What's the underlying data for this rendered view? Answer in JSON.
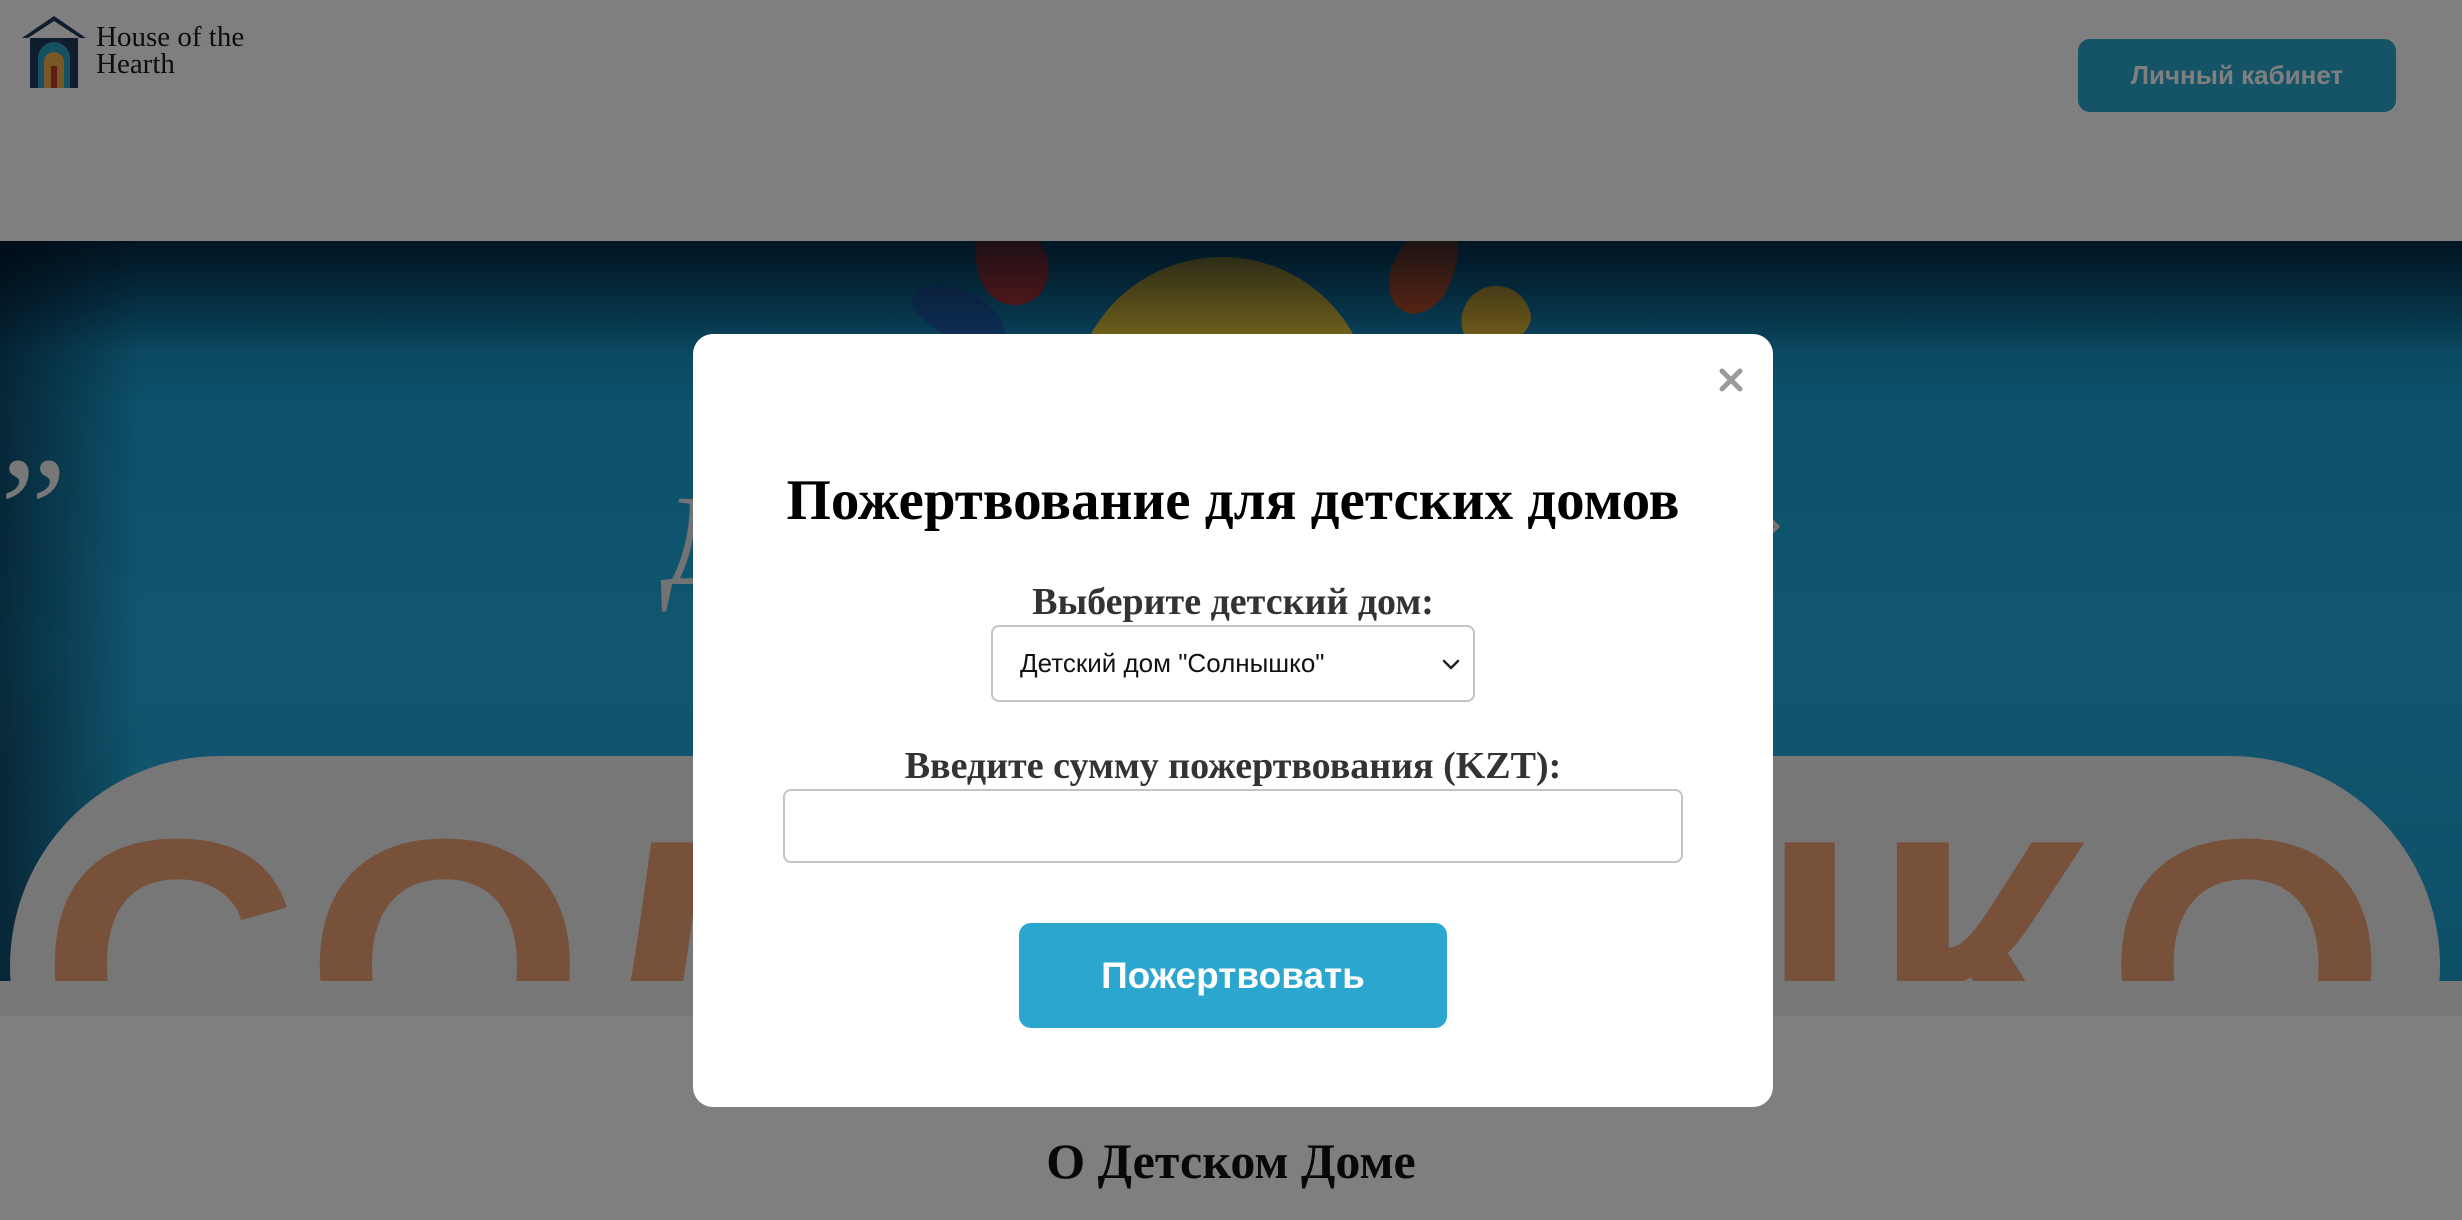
{
  "header": {
    "logo_line1": "House of the",
    "logo_line2": "Hearth",
    "cabinet_button": "Личный кабинет"
  },
  "hero": {
    "quote_mark": "„",
    "partial_letter": "Д",
    "next_arrow": "›",
    "sign_text": "СОЛНЫШКО"
  },
  "section": {
    "about_title": "О Детском Доме"
  },
  "modal": {
    "title": "Пожертвование для детских домов",
    "select_label": "Выберите детский дом:",
    "selected_home": "Детский дом \"Солнышко\"",
    "amount_label": "Введите сумму пожертвования (KZT):",
    "amount_value": "",
    "amount_placeholder": "",
    "submit_button": "Пожертвовать",
    "close_icon": "close-icon"
  },
  "colors": {
    "accent": "#2ba7cf",
    "overlay": "rgba(0,0,0,0.5)",
    "sign_letters": "#f0a277",
    "hero_blue": "#22aee0"
  }
}
